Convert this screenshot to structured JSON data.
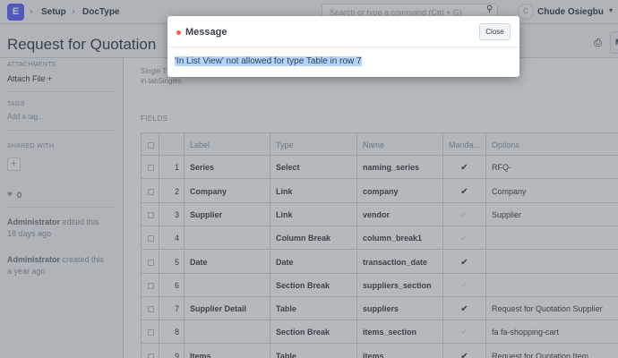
{
  "navbar": {
    "logo": "E",
    "breadcrumbs": [
      "Setup",
      "DocType"
    ],
    "search_placeholder": "Search or type a command (Ctrl + G)",
    "avatar_initial": "C",
    "user_name": "Chude Osiegbu"
  },
  "page": {
    "title": "Request for Quotation",
    "header_button": "M"
  },
  "sidebar": {
    "attachments_heading": "ATTACHMENTS",
    "attach_file": "Attach File",
    "tags_heading": "TAGS",
    "add_tag": "Add a tag...",
    "shared_heading": "SHARED WITH",
    "likes": "0",
    "timeline": [
      {
        "user": "Administrator",
        "action": "edited this",
        "when": "18 days ago"
      },
      {
        "user": "Administrator",
        "action": "created this",
        "when": "a year ago"
      }
    ]
  },
  "main": {
    "intro_line1": "Single T",
    "intro_line2": "in tabSingles",
    "fields_heading": "FIELDS",
    "columns": {
      "label": "Label",
      "type": "Type",
      "name": "Name",
      "mandatory": "Manda...",
      "options": "Options"
    },
    "rows": [
      {
        "idx": "1",
        "label": "Series",
        "type": "Select",
        "name": "naming_series",
        "mandatory": true,
        "options": "RFQ-"
      },
      {
        "idx": "2",
        "label": "Company",
        "type": "Link",
        "name": "company",
        "mandatory": true,
        "options": "Company"
      },
      {
        "idx": "3",
        "label": "Supplier",
        "type": "Link",
        "name": "vendor",
        "mandatory": false,
        "options": "Supplier"
      },
      {
        "idx": "4",
        "label": "",
        "type": "Column Break",
        "name": "column_break1",
        "mandatory": false,
        "options": ""
      },
      {
        "idx": "5",
        "label": "Date",
        "type": "Date",
        "name": "transaction_date",
        "mandatory": true,
        "options": ""
      },
      {
        "idx": "6",
        "label": "",
        "type": "Section Break",
        "name": "suppliers_section",
        "mandatory": false,
        "options": ""
      },
      {
        "idx": "7",
        "label": "Supplier Detail",
        "type": "Table",
        "name": "suppliers",
        "mandatory": true,
        "options": "Request for Quotation Supplier"
      },
      {
        "idx": "8",
        "label": "",
        "type": "Section Break",
        "name": "items_section",
        "mandatory": false,
        "options": "fa fa-shopping-cart"
      },
      {
        "idx": "9",
        "label": "Items",
        "type": "Table",
        "name": "items",
        "mandatory": true,
        "options": "Request for Quotation Item"
      }
    ]
  },
  "modal": {
    "title": "Message",
    "close_label": "Close",
    "message": "'In List View' not allowed for type Table in row 7",
    "indicator_color": "#ff5858"
  }
}
